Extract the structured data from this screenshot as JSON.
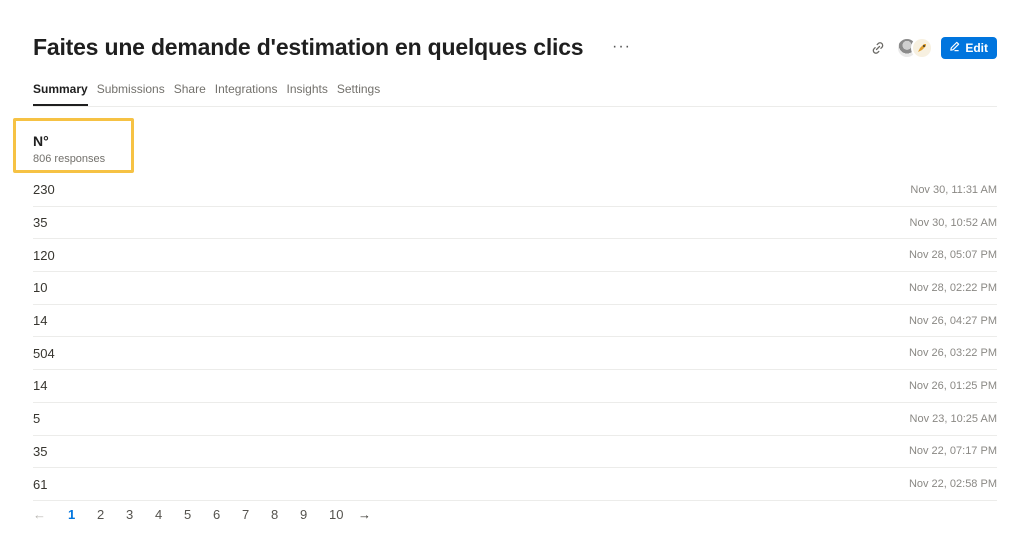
{
  "form": {
    "title": "Faites une demande d'estimation en quelques clics",
    "more_label": "···"
  },
  "toolbar": {
    "edit_label": "Edit",
    "icons": [
      "link-icon",
      "pencil-icon"
    ]
  },
  "tabs": [
    {
      "label": "Summary",
      "active": true
    },
    {
      "label": "Submissions",
      "active": false
    },
    {
      "label": "Share",
      "active": false
    },
    {
      "label": "Integrations",
      "active": false
    },
    {
      "label": "Insights",
      "active": false
    },
    {
      "label": "Settings",
      "active": false
    }
  ],
  "field": {
    "title": "N°",
    "responses": "806 responses"
  },
  "responses": [
    {
      "value": "230",
      "time": "Nov 30, 11:31 AM"
    },
    {
      "value": "35",
      "time": "Nov 30, 10:52 AM"
    },
    {
      "value": "120",
      "time": "Nov 28, 05:07 PM"
    },
    {
      "value": "10",
      "time": "Nov 28, 02:22 PM"
    },
    {
      "value": "14",
      "time": "Nov 26, 04:27 PM"
    },
    {
      "value": "504",
      "time": "Nov 26, 03:22 PM"
    },
    {
      "value": "14",
      "time": "Nov 26, 01:25 PM"
    },
    {
      "value": "5",
      "time": "Nov 23, 10:25 AM"
    },
    {
      "value": "35",
      "time": "Nov 22, 07:17 PM"
    },
    {
      "value": "61",
      "time": "Nov 22, 02:58 PM"
    }
  ],
  "pagination": {
    "prev": "←",
    "pages": [
      "1",
      "2",
      "3",
      "4",
      "5",
      "6",
      "7",
      "8",
      "9",
      "10"
    ],
    "current": "1",
    "next": "→"
  },
  "colors": {
    "accent": "#0075de",
    "highlight": "#f6c244"
  }
}
